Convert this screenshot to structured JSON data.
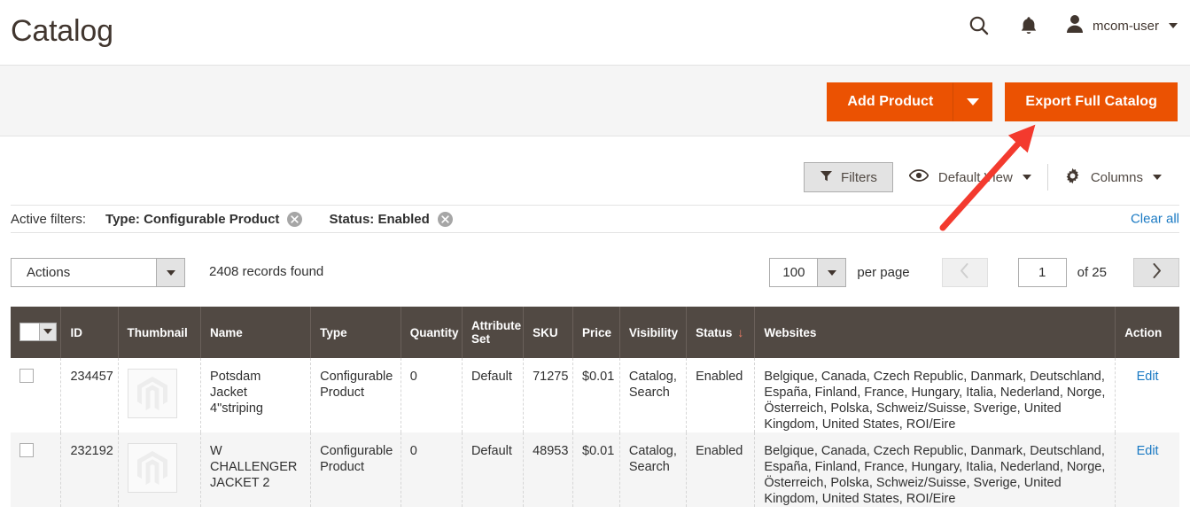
{
  "header": {
    "title": "Catalog",
    "search_icon": "search-icon",
    "notifications_icon": "bell-icon",
    "user_icon": "user-avatar-icon",
    "user_name": "mcom-user"
  },
  "toolbar_buttons": {
    "add_product_label": "Add Product",
    "add_product_caret": "chevron-down-icon",
    "export_label": "Export Full Catalog",
    "primary_color": "#eb5202"
  },
  "view_controls": {
    "filters_label": "Filters",
    "filters_icon": "funnel-icon",
    "view_icon": "eye-icon",
    "view_label": "Default View",
    "columns_icon": "gear-icon",
    "columns_label": "Columns"
  },
  "active_filters": {
    "label": "Active filters:",
    "chips": [
      {
        "text": "Type: Configurable Product"
      },
      {
        "text": "Status: Enabled"
      }
    ],
    "clear_all_label": "Clear all",
    "link_color": "#1979c3"
  },
  "grid_toolbar": {
    "actions_label": "Actions",
    "records_found": "2408 records found",
    "per_page_value": "100",
    "per_page_label": "per page",
    "prev_icon": "chevron-left-icon",
    "next_icon": "chevron-right-icon",
    "page_value": "1",
    "of_label": "of 25"
  },
  "grid": {
    "header_bg": "#514943",
    "columns": [
      {
        "key": "check",
        "label": ""
      },
      {
        "key": "id",
        "label": "ID"
      },
      {
        "key": "thumbnail",
        "label": "Thumbnail"
      },
      {
        "key": "name",
        "label": "Name"
      },
      {
        "key": "type",
        "label": "Type"
      },
      {
        "key": "quantity",
        "label": "Quantity"
      },
      {
        "key": "attr_set",
        "label": "Attribute Set"
      },
      {
        "key": "sku",
        "label": "SKU"
      },
      {
        "key": "price",
        "label": "Price"
      },
      {
        "key": "visibility",
        "label": "Visibility"
      },
      {
        "key": "status",
        "label": "Status",
        "sorted": "desc",
        "sort_glyph": "↓"
      },
      {
        "key": "websites",
        "label": "Websites"
      },
      {
        "key": "action",
        "label": "Action"
      }
    ],
    "rows": [
      {
        "id": "234457",
        "thumbnail": "magento-placeholder-icon",
        "name": "Potsdam Jacket 4\"striping",
        "type": "Configurable Product",
        "quantity": "0",
        "attr_set": "Default",
        "sku": "71275",
        "price": "$0.01",
        "visibility": "Catalog, Search",
        "status": "Enabled",
        "websites": "Belgique, Canada, Czech Republic, Danmark, Deutschland, España, Finland, France, Hungary, Italia, Nederland, Norge, Österreich, Polska, Schweiz/Suisse, Sverige, United Kingdom, United States, ROI/Eire",
        "action": "Edit"
      },
      {
        "id": "232192",
        "thumbnail": "magento-placeholder-icon",
        "name": "W CHALLENGER JACKET 2",
        "type": "Configurable Product",
        "quantity": "0",
        "attr_set": "Default",
        "sku": "48953",
        "price": "$0.01",
        "visibility": "Catalog, Search",
        "status": "Enabled",
        "websites": "Belgique, Canada, Czech Republic, Danmark, Deutschland, España, Finland, France, Hungary, Italia, Nederland, Norge, Österreich, Polska, Schweiz/Suisse, Sverige, United Kingdom, United States, ROI/Eire",
        "action": "Edit"
      }
    ]
  },
  "annotation": {
    "type": "arrow",
    "color": "#f33a2e",
    "points_to": "export-full-catalog-button"
  }
}
